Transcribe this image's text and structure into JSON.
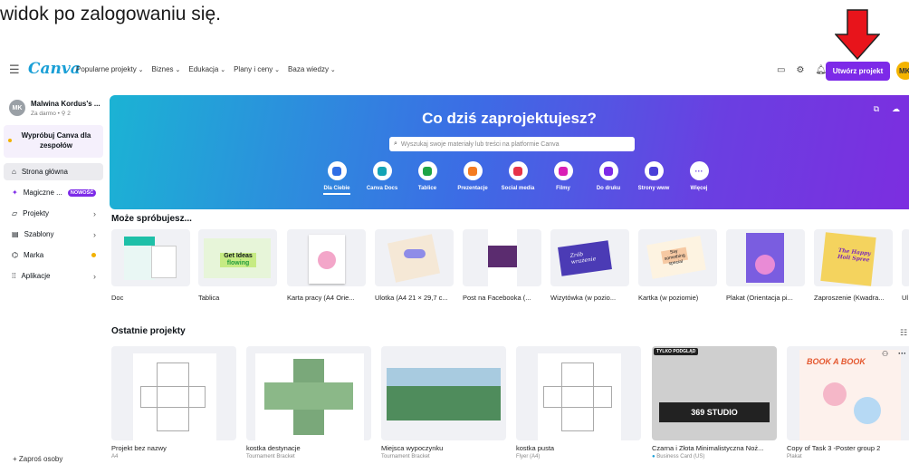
{
  "caption": "widok po zalogowaniu się.",
  "app": {
    "logo": "Canva",
    "nav": [
      "Popularne projekty",
      "Biznes",
      "Edukacja",
      "Plany i ceny",
      "Baza wiedzy"
    ],
    "create_button": "Utwórz projekt",
    "avatar_initials": "MK"
  },
  "sidebar": {
    "account_name": "Malwina Kordus's ...",
    "account_sub": "Za darmo • ⚲ 2",
    "avatar_initials": "MK",
    "try_label": "Wypróbuj Canva dla zespołów",
    "items": [
      {
        "label": "Strona główna",
        "icon": "home-icon"
      },
      {
        "label": "Magiczne ...",
        "icon": "sparkle-icon",
        "badge": "NOWOŚĆ"
      },
      {
        "label": "Projekty",
        "icon": "folder-icon"
      },
      {
        "label": "Szablony",
        "icon": "template-icon"
      },
      {
        "label": "Marka",
        "icon": "brand-icon"
      },
      {
        "label": "Aplikacje",
        "icon": "apps-icon"
      }
    ],
    "invite": "+ Zaproś osoby"
  },
  "hero": {
    "title": "Co dziś zaprojektujesz?",
    "search_placeholder": "Wyszukaj swoje materiały lub treści na platformie Canva",
    "categories": [
      {
        "label": "Dla Ciebie",
        "color": "#2f6ee5"
      },
      {
        "label": "Canva Docs",
        "color": "#13a3b5"
      },
      {
        "label": "Tablice",
        "color": "#1ea446"
      },
      {
        "label": "Prezentacje",
        "color": "#f47b20"
      },
      {
        "label": "Social media",
        "color": "#e6334a"
      },
      {
        "label": "Filmy",
        "color": "#d91fb5"
      },
      {
        "label": "Do druku",
        "color": "#7d2ae8"
      },
      {
        "label": "Strony www",
        "color": "#4a3fd8"
      },
      {
        "label": "Więcej",
        "color": "#6a3fe1"
      }
    ]
  },
  "suggestions": {
    "title": "Może spróbujesz...",
    "items": [
      "Doc",
      "Tablica",
      "Karta pracy (A4 Orie...",
      "Ulotka (A4 21 × 29,7 c...",
      "Post na Facebooka (...",
      "Wizytówka (w pozio...",
      "Kartka (w poziomie)",
      "Plakat (Orientacja pi...",
      "Zaproszenie (Kwadra...",
      "Ul"
    ]
  },
  "recent": {
    "title": "Ostatnie projekty",
    "items": [
      {
        "name": "Projekt bez nazwy",
        "sub": "A4"
      },
      {
        "name": "kostka destynacje",
        "sub": "Tournament Bracket"
      },
      {
        "name": "Miejsca wypoczynku",
        "sub": "Tournament Bracket"
      },
      {
        "name": "kostka pusta",
        "sub": "Flyer (A4)"
      },
      {
        "name": "Czarna i Złota Minimalistyczna Noż...",
        "sub": "Business Card (US)"
      },
      {
        "name": "Copy of Task 3 -Poster group 2",
        "sub": "Plakat"
      }
    ],
    "badge_preview": "TYLKO PODGLĄD",
    "studio_text": "369 STUDIO",
    "book_text": "BOOK A BOOK"
  },
  "colors": {
    "accent": "#7d2ae8",
    "arrow": "#e8141b"
  }
}
